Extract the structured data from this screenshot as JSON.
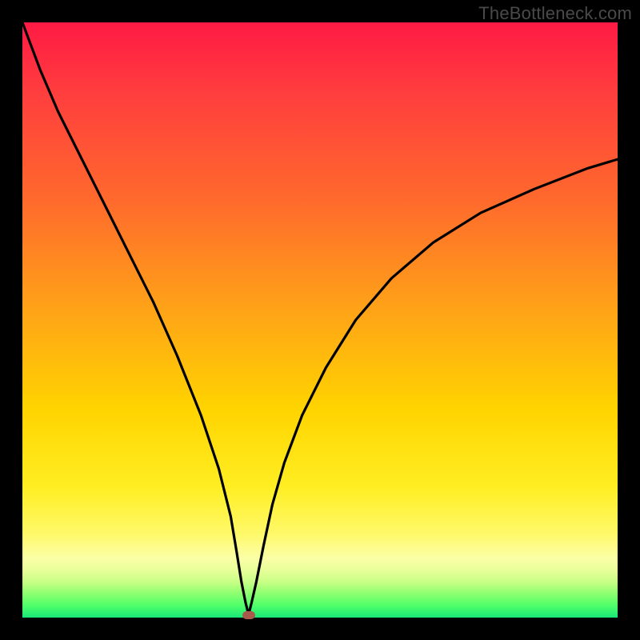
{
  "watermark": "TheBottleneck.com",
  "chart_data": {
    "type": "line",
    "title": "",
    "xlabel": "",
    "ylabel": "",
    "xlim": [
      0,
      100
    ],
    "ylim": [
      0,
      100
    ],
    "series": [
      {
        "name": "curve",
        "x": [
          0,
          3,
          6,
          10,
          14,
          18,
          22,
          26,
          30,
          33,
          35,
          36,
          36.8,
          37.5,
          38,
          38.5,
          39.3,
          40.5,
          42,
          44,
          47,
          51,
          56,
          62,
          69,
          77,
          86,
          95,
          100
        ],
        "y": [
          100,
          92,
          85,
          77,
          69,
          61,
          53,
          44,
          34,
          25,
          17,
          11,
          6,
          2.5,
          0.5,
          2.5,
          6,
          12,
          19,
          26,
          34,
          42,
          50,
          57,
          63,
          68,
          72,
          75.5,
          77
        ]
      }
    ],
    "marker": {
      "x": 38,
      "y": 0
    },
    "background_gradient": {
      "top": "#ff1a44",
      "mid": "#ffd400",
      "bottom": "#18e676"
    }
  }
}
